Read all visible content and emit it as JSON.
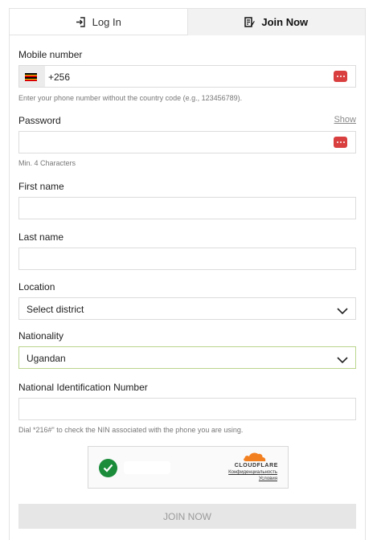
{
  "tabs": {
    "login": "Log In",
    "join": "Join Now"
  },
  "mobile": {
    "label": "Mobile number",
    "prefix": "+256",
    "hint": "Enter your phone number without the country code (e.g., 123456789).",
    "flag_colors": [
      "#000000",
      "#FCDC04",
      "#D90000",
      "#000000",
      "#FCDC04",
      "#D90000"
    ]
  },
  "password": {
    "label": "Password",
    "show": "Show",
    "hint": "Min. 4 Characters"
  },
  "first_name": {
    "label": "First name"
  },
  "last_name": {
    "label": "Last name"
  },
  "location": {
    "label": "Location",
    "value": "Select district"
  },
  "nationality": {
    "label": "Nationality",
    "value": "Ugandan"
  },
  "nin": {
    "label": "National Identification Number",
    "hint": "Dial *216#\" to check the NIN associated with the phone you are using."
  },
  "captcha": {
    "brand": "CLOUDFLARE",
    "privacy": "Конфиденциальность",
    "terms": "Условия"
  },
  "submit": {
    "label": "JOIN NOW"
  },
  "colors": {
    "accent_red": "#D93F3F",
    "success_green": "#1A8C3A",
    "cloudflare_orange": "#F38020",
    "focus_border": "#B9D58C"
  }
}
